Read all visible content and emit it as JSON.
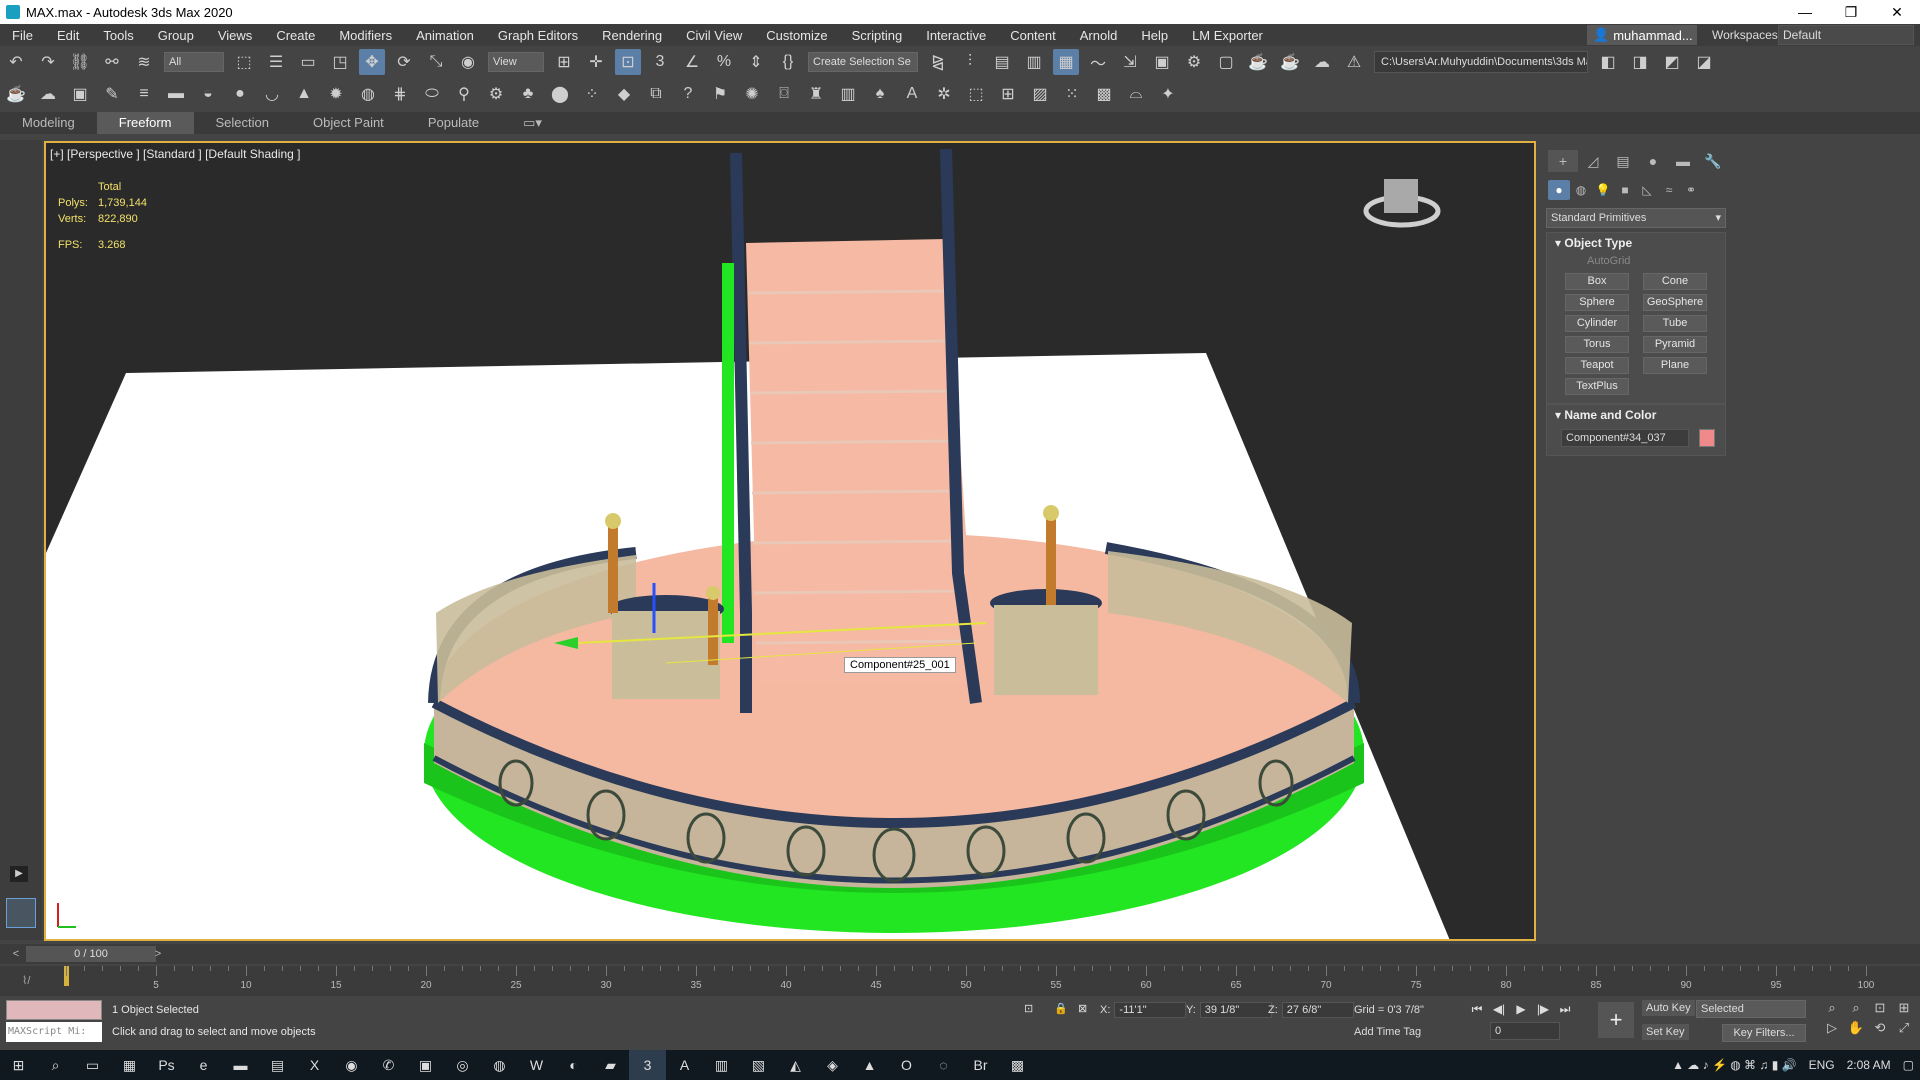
{
  "window": {
    "title": "MAX.max - Autodesk 3ds Max 2020",
    "controls": [
      "—",
      "❐",
      "✕"
    ]
  },
  "menu": {
    "items": [
      "File",
      "Edit",
      "Tools",
      "Group",
      "Views",
      "Create",
      "Modifiers",
      "Animation",
      "Graph Editors",
      "Rendering",
      "Civil View",
      "Customize",
      "Scripting",
      "Interactive",
      "Content",
      "Arnold",
      "Help",
      "LM Exporter"
    ],
    "user": "muhammad...",
    "workspaces_label": "Workspaces:",
    "workspace_value": "Default"
  },
  "toolbar1": {
    "filter_value": "All",
    "view_value": "View",
    "selection_set_placeholder": "Create Selection Se",
    "project_path": "C:\\Users\\Ar.Muhyuddin\\Documents\\3ds Max 2020"
  },
  "ribbon": {
    "tabs": [
      "Modeling",
      "Freeform",
      "Selection",
      "Object Paint",
      "Populate"
    ],
    "active": "Freeform"
  },
  "viewport": {
    "label": "[+] [Perspective ] [Standard ] [Default Shading ]",
    "stats_header": "Total",
    "polys_label": "Polys:",
    "polys": "1,739,144",
    "verts_label": "Verts:",
    "verts": "822,890",
    "fps_label": "FPS:",
    "fps": "3.268",
    "tooltip": "Component#25_001"
  },
  "command_panel": {
    "category": "Standard Primitives",
    "object_type_title": "Object Type",
    "autogrid": "AutoGrid",
    "buttons": [
      "Box",
      "Cone",
      "Sphere",
      "GeoSphere",
      "Cylinder",
      "Tube",
      "Torus",
      "Pyramid",
      "Teapot",
      "Plane",
      "TextPlus"
    ],
    "name_color_title": "Name and Color",
    "object_name": "Component#34_037",
    "object_color": "#f08a8a"
  },
  "timeline": {
    "frame_counter": "0 / 100",
    "ticks": [
      "5",
      "10",
      "15",
      "20",
      "25",
      "30",
      "35",
      "40",
      "45",
      "50",
      "55",
      "60",
      "65",
      "70",
      "75",
      "80",
      "85",
      "90",
      "95",
      "100"
    ]
  },
  "status": {
    "maxscript": "MAXScript Mi:",
    "selection": "1 Object Selected",
    "prompt": "Click and drag to select and move objects",
    "x_label": "X:",
    "x": "-11'1\"",
    "y_label": "Y:",
    "y": "39 1/8\"",
    "z_label": "Z:",
    "z": "27 6/8\"",
    "grid": "Grid = 0'3 7/8\"",
    "add_time_tag": "Add Time Tag",
    "frame": "0",
    "auto_key": "Auto Key",
    "set_key": "Set Key",
    "selected": "Selected",
    "key_filters": "Key Filters..."
  },
  "taskbar": {
    "lang": "ENG",
    "time": "2:08 AM"
  }
}
